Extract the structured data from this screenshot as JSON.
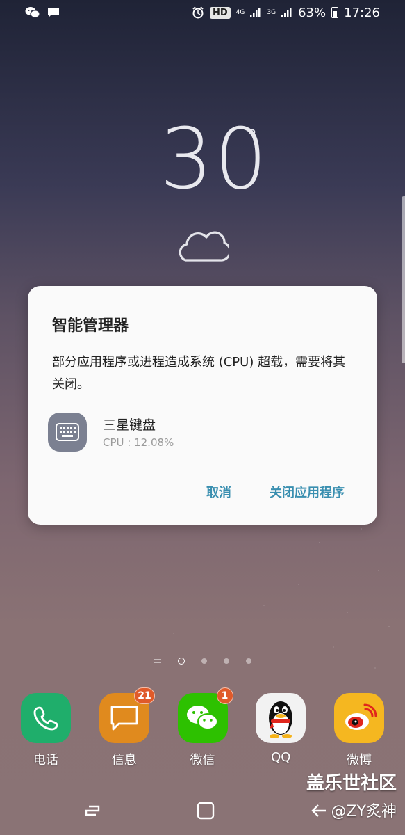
{
  "status_bar": {
    "icons_left": [
      "wechat-icon",
      "message-icon"
    ],
    "hd": "HD",
    "net1": "4G",
    "net2": "3G",
    "battery": "63%",
    "time": "17:26"
  },
  "weather": {
    "temperature": "30",
    "degree": "°",
    "icon": "cloud-icon"
  },
  "dialog": {
    "title": "智能管理器",
    "message": "部分应用程序或进程造成系统 (CPU) 超载，需要将其关闭。",
    "app_name": "三星键盘",
    "app_cpu": "CPU : 12.08%",
    "cancel": "取消",
    "close_app": "关闭应用程序"
  },
  "dock": [
    {
      "label": "电话",
      "icon": "phone-icon",
      "color": "#1fae6b"
    },
    {
      "label": "信息",
      "icon": "message-icon",
      "color": "#e08a1e",
      "badge": "21"
    },
    {
      "label": "微信",
      "icon": "wechat-icon",
      "color": "#2dc100",
      "badge": "1"
    },
    {
      "label": "QQ",
      "icon": "qq-penguin-icon",
      "color": "#f2f2f2"
    },
    {
      "label": "微博",
      "icon": "weibo-icon",
      "color": "#f5b720"
    }
  ],
  "watermark": {
    "line1": "盖乐世社区",
    "line2": "@ZY炙神"
  }
}
